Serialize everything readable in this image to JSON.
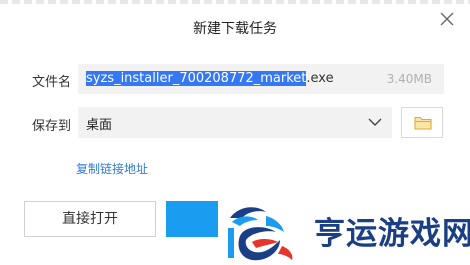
{
  "dialog": {
    "title": "新建下载任务"
  },
  "file": {
    "label": "文件名",
    "name_selected": "syzs_installer_700208772_market",
    "name_ext": ".exe",
    "size": "3.40MB"
  },
  "save": {
    "label": "保存到",
    "location": "桌面"
  },
  "links": {
    "copy_link": "复制链接地址"
  },
  "buttons": {
    "open": "直接打开"
  },
  "watermark": {
    "text": "亨运游戏网"
  },
  "colors": {
    "selection": "#3478f6",
    "primary_button": "#1a9cf0",
    "link": "#2f7bd8",
    "watermark": "#1b3f84"
  },
  "icons": {
    "close": "close-icon",
    "chevron": "chevron-down-icon",
    "folder": "folder-icon"
  }
}
